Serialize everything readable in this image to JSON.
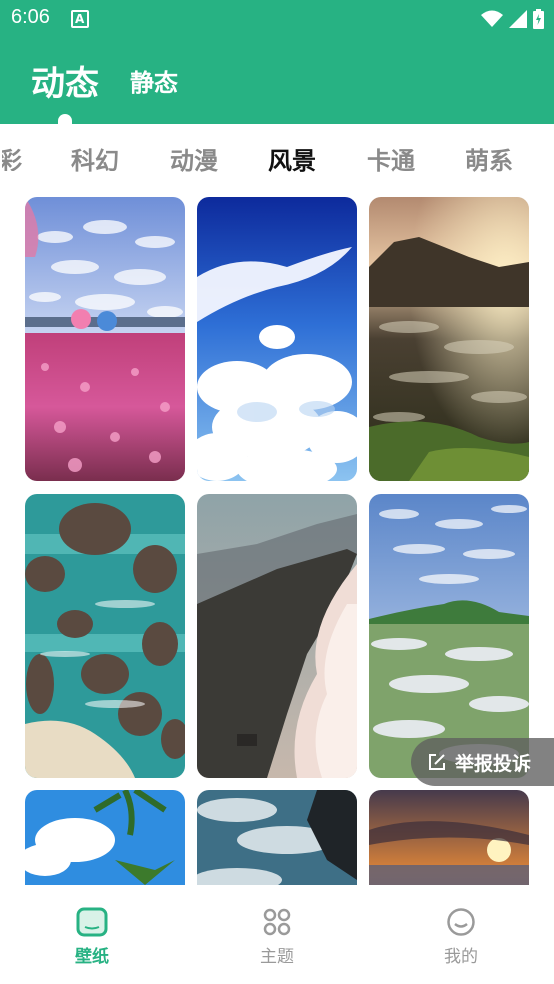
{
  "status_bar": {
    "time": "6:06",
    "app_icon": "a-icon"
  },
  "top_tabs": {
    "active": "动态",
    "inactive": "静态"
  },
  "categories": {
    "partial": "彩",
    "items": [
      "科幻",
      "动漫",
      "风景",
      "卡通",
      "萌系"
    ],
    "active_index": 2
  },
  "wallpapers": [
    "flower-field-wallpaper",
    "blue-sky-clouds-wallpaper",
    "mountain-sunbeam-wallpaper",
    "sea-rocks-wallpaper",
    "cloud-ridge-wallpaper",
    "flower-meadow-sky-wallpaper",
    "palm-sky-wallpaper",
    "ocean-waves-wallpaper",
    "sunset-sea-wallpaper"
  ],
  "report_button": {
    "label": "举报投诉"
  },
  "bottom_nav": [
    {
      "label": "壁纸",
      "icon": "wallpaper-icon",
      "active": true
    },
    {
      "label": "主题",
      "icon": "theme-grid-icon",
      "active": false
    },
    {
      "label": "我的",
      "icon": "smiley-icon",
      "active": false
    }
  ],
  "colors": {
    "primary": "#27b283",
    "inactive_text": "#8a8a8a",
    "active_text": "#111111"
  }
}
